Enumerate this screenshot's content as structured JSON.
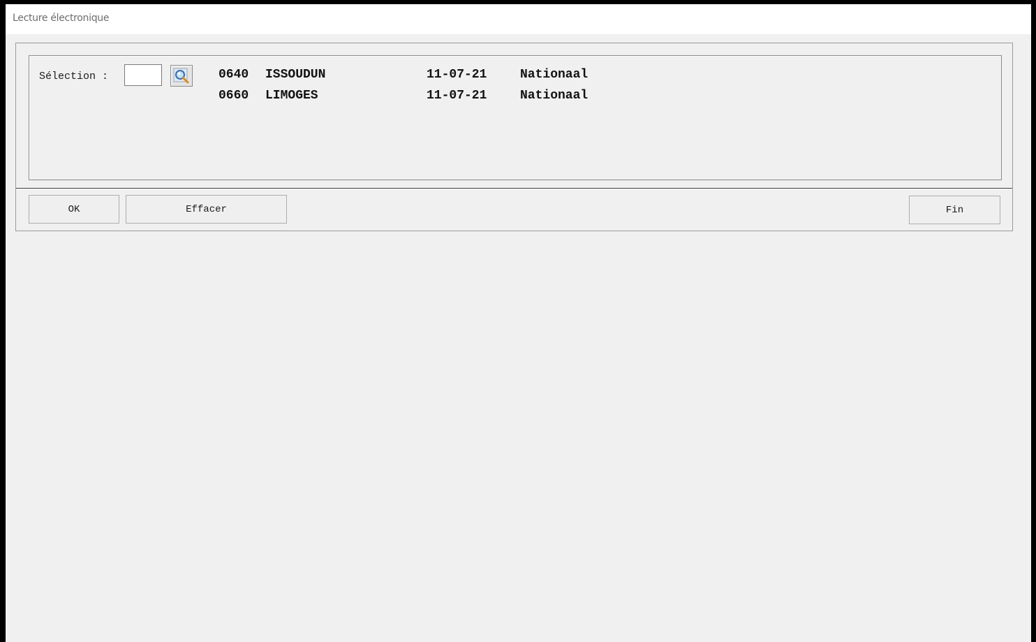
{
  "window": {
    "title": "Lecture électronique"
  },
  "selection": {
    "label": "Sélection :",
    "input_value": "",
    "search_icon": "magnifier-icon"
  },
  "rows": [
    {
      "code": "0640",
      "city": "ISSOUDUN",
      "date": "11-07-21",
      "type": "Nationaal"
    },
    {
      "code": "0660",
      "city": "LIMOGES",
      "date": "11-07-21",
      "type": "Nationaal"
    }
  ],
  "buttons": {
    "ok": "OK",
    "effacer": "Effacer",
    "fin": "Fin"
  }
}
